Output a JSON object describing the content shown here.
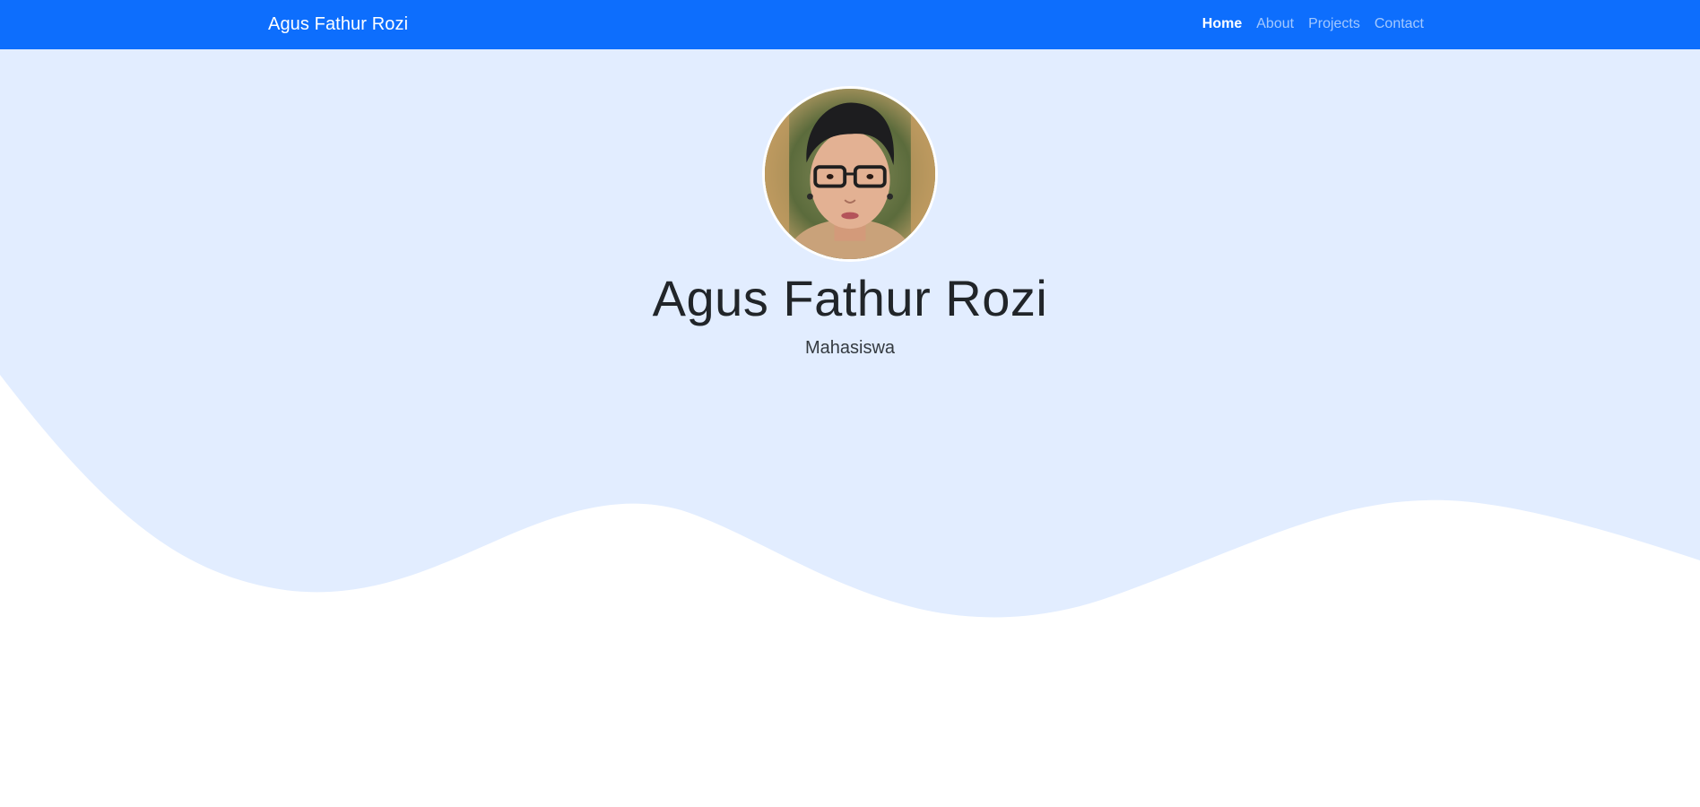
{
  "navbar": {
    "brand": "Agus Fathur Rozi",
    "items": [
      {
        "label": "Home",
        "active": true
      },
      {
        "label": "About",
        "active": false
      },
      {
        "label": "Projects",
        "active": false
      },
      {
        "label": "Contact",
        "active": false
      }
    ]
  },
  "hero": {
    "name": "Agus Fathur Rozi",
    "subtitle": "Mahasiswa"
  },
  "colors": {
    "navbar_bg": "#0d6efd",
    "hero_bg": "#e2edff",
    "wave_fill": "#ffffff"
  },
  "icons": {
    "avatar": "profile-photo"
  }
}
